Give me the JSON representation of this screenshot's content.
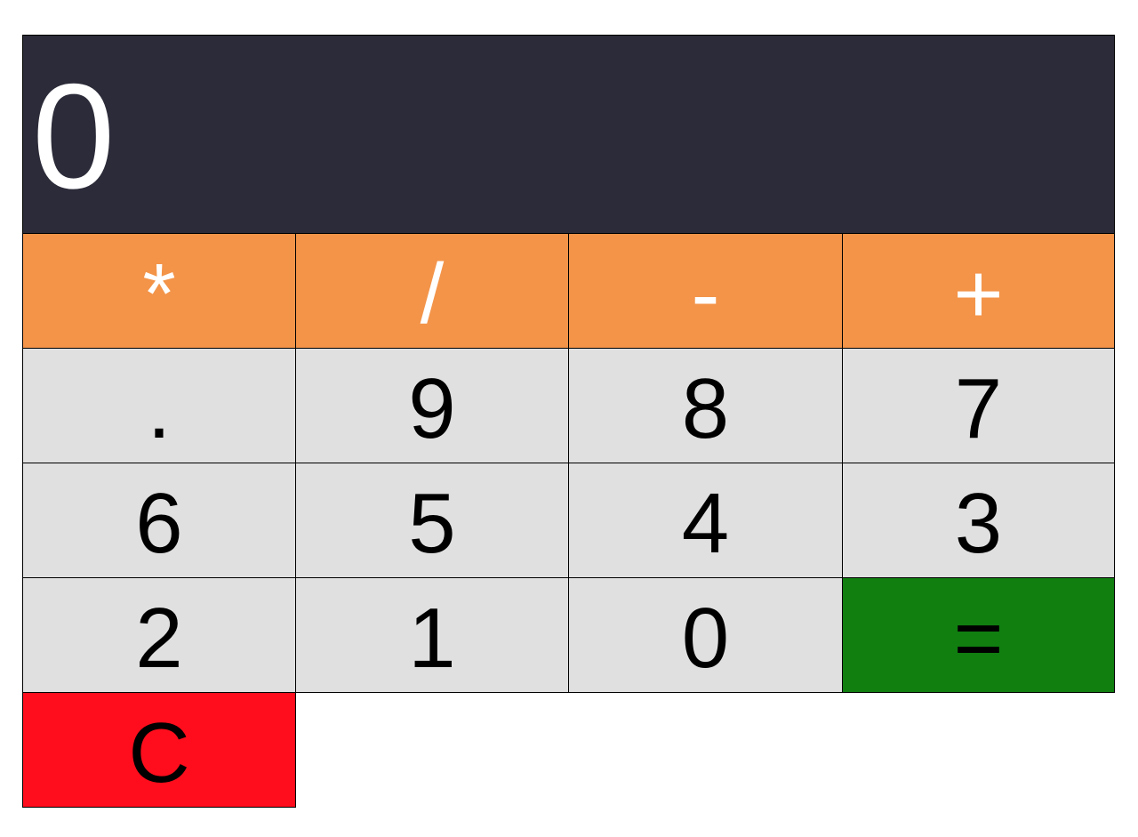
{
  "display": {
    "value": "0"
  },
  "operators": [
    "*",
    "/",
    "-",
    "+"
  ],
  "rows": [
    [
      ".",
      "9",
      "8",
      "7"
    ],
    [
      "6",
      "5",
      "4",
      "3"
    ],
    [
      "2",
      "1",
      "0"
    ]
  ],
  "equals_label": "=",
  "clear_label": "C",
  "colors": {
    "display_bg": "#2b2b39",
    "operator_bg": "#f39449",
    "number_bg": "#e0e0e0",
    "equals_bg": "#107f10",
    "clear_bg": "#ff0d1c"
  }
}
